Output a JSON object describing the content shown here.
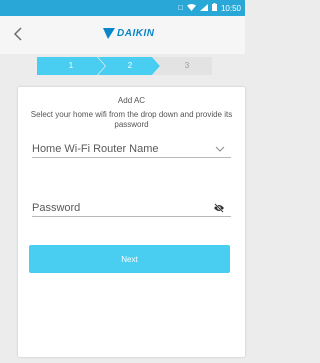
{
  "status_bar": {
    "time": "10:50",
    "icons": [
      "vibrate-icon",
      "wifi-icon",
      "signal-icon",
      "battery-icon"
    ]
  },
  "header": {
    "back_icon": "chevron-left-icon",
    "logo_text": "DAIKIN",
    "colors": {
      "brand": "#0a87c8",
      "status_bar": "#29a8d8"
    }
  },
  "stepper": {
    "steps": [
      "1",
      "2",
      "3"
    ],
    "current_step": 2,
    "colors": {
      "active": "#49cdf0",
      "inactive": "#e3e3e3"
    }
  },
  "card": {
    "title": "Add AC",
    "instructions": "Select your home wifi from the drop down and provide its password",
    "wifi_field": {
      "placeholder": "Home Wi-Fi Router Name",
      "icon": "chevron-down-icon"
    },
    "password_field": {
      "placeholder": "Password",
      "icon": "eye-off-icon"
    },
    "next_label": "Next",
    "button_color": "#49cdf0"
  }
}
